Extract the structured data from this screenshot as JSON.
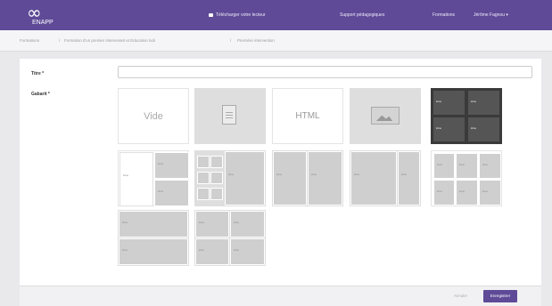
{
  "brand": {
    "name": "ENAPP"
  },
  "nav": {
    "download": "Télécharger votre lecteur",
    "support": "Support pédagogiques",
    "formations": "Formations",
    "user": "Jérôme Fagnou ▾"
  },
  "breadcrumb": [
    "Formations",
    "Formation d'un premier intervenant et Éducation ludi",
    "Première intervention"
  ],
  "breadcrumb_sep": "/",
  "form": {
    "title_label": "Titre *",
    "template_label": "Gabarit *",
    "title_value": ""
  },
  "tiles": {
    "vide": "Vide",
    "html": "HTML",
    "zone": "Zone"
  },
  "footer": {
    "cancel": "Annuler",
    "save": "Enregistrer"
  },
  "colors": {
    "brand": "#5e4a97",
    "tile_grey": "#dedede",
    "tile_dark": "#3a3a3a"
  },
  "icons": [
    "download-icon",
    "document-icon",
    "image-icon",
    "caret-down-icon"
  ]
}
